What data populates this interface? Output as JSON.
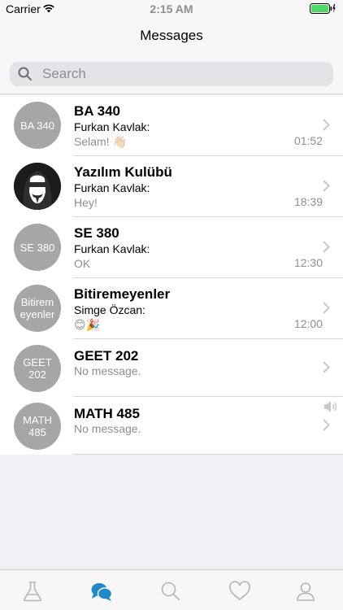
{
  "status": {
    "carrier": "Carrier",
    "time": "2:15 AM"
  },
  "nav": {
    "title": "Messages"
  },
  "search": {
    "placeholder": "Search"
  },
  "conversations": [
    {
      "avatar_text": "BA 340",
      "name": "BA 340",
      "sender": "Furkan Kavlak:",
      "preview": "Selam! 👋🏻",
      "time": "01:52"
    },
    {
      "avatar_text": "",
      "avatar_icon": "anonymous-mask-avatar",
      "name": "Yazılım Kulübü",
      "sender": "Furkan Kavlak:",
      "preview": "Hey!",
      "time": "18:39"
    },
    {
      "avatar_text": "SE 380",
      "name": "SE 380",
      "sender": "Furkan Kavlak:",
      "preview": "OK",
      "time": "12:30"
    },
    {
      "avatar_text": "Bitirem eyenler",
      "name": "Bitiremeyenler",
      "sender": "Simge Özcan:",
      "preview": "😊🎉",
      "time": "12:00"
    },
    {
      "avatar_text": "GEET 202",
      "name": "GEET 202",
      "sender": "",
      "preview": "No message.",
      "time": ""
    },
    {
      "avatar_text": "MATH 485",
      "name": "MATH 485",
      "sender": "",
      "preview": "No message.",
      "time": "",
      "muted": true
    }
  ],
  "tabs": [
    {
      "icon": "flask-icon",
      "selected": false
    },
    {
      "icon": "chat-bubbles-icon",
      "selected": true
    },
    {
      "icon": "search-icon",
      "selected": false
    },
    {
      "icon": "heart-icon",
      "selected": false
    },
    {
      "icon": "profile-icon",
      "selected": false
    }
  ],
  "colors": {
    "accent": "#1e88c9",
    "tab_inactive": "#b5b5ba",
    "avatar_gray": "#a6a6a6",
    "secondary_text": "#8e8e93"
  }
}
